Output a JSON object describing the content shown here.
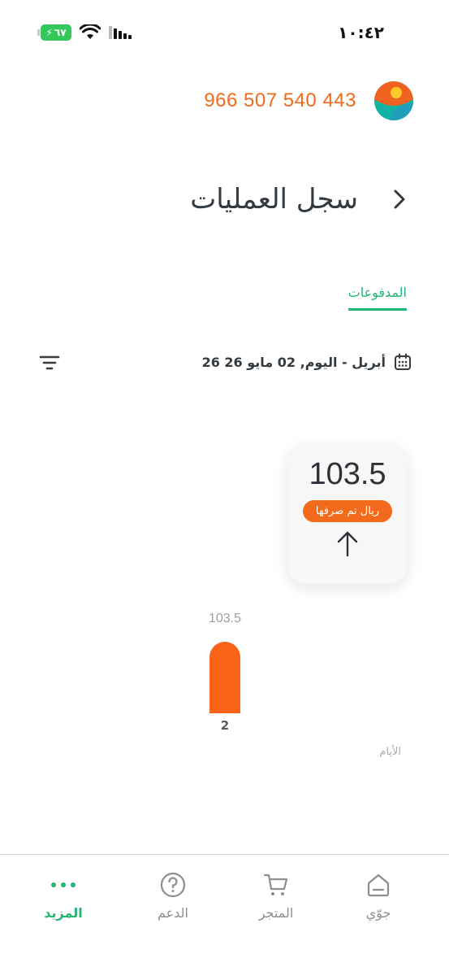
{
  "status_bar": {
    "time": "١٠:٤٢",
    "battery_level": "٦٧",
    "icons": [
      "battery-icon",
      "wifi-icon",
      "signal-icon"
    ]
  },
  "account": {
    "phone_number": "966 507 540 443"
  },
  "header": {
    "title": "سجل العمليات",
    "back_icon": "chevron-right-icon"
  },
  "tabs": [
    {
      "label": "المدفوعات",
      "active": true
    }
  ],
  "date_filter": {
    "range": "26 أبريل - اليوم, 02 مايو 26",
    "icons": [
      "calendar-icon",
      "filter-icon"
    ]
  },
  "summary": {
    "amount": "103.5",
    "badge_label": "ريال تم صرفها",
    "icon": "arrow-up-icon"
  },
  "chart_data": {
    "type": "bar",
    "categories": [
      "2"
    ],
    "values": [
      103.5
    ],
    "value_labels": [
      "103.5"
    ],
    "xlabel": "الأيام",
    "ylabel": "",
    "title": "",
    "bar_color": "#fa6419",
    "grid": false
  },
  "bottom_nav": {
    "items": [
      {
        "label": "جوّي",
        "icon": "home-icon",
        "active": false
      },
      {
        "label": "المتجر",
        "icon": "cart-icon",
        "active": false
      },
      {
        "label": "الدعم",
        "icon": "help-icon",
        "active": false
      },
      {
        "label": "المزيد",
        "icon": "more-icon",
        "active": true
      }
    ]
  },
  "colors": {
    "accent": "#f26a1b",
    "brand_green": "#22b573",
    "text": "#333a40",
    "muted": "#8a8f94"
  }
}
